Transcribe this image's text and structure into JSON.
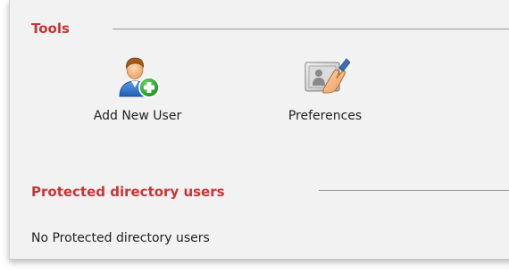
{
  "tools_section": {
    "title": "Tools",
    "items": [
      {
        "label": "Add New User",
        "icon": "add-user-icon"
      },
      {
        "label": "Preferences",
        "icon": "preferences-icon"
      }
    ]
  },
  "protected_users_section": {
    "title": "Protected directory users",
    "empty_message": "No Protected directory users"
  },
  "colors": {
    "section_header": "#c63636",
    "panel_background": "#f2f2f2"
  }
}
